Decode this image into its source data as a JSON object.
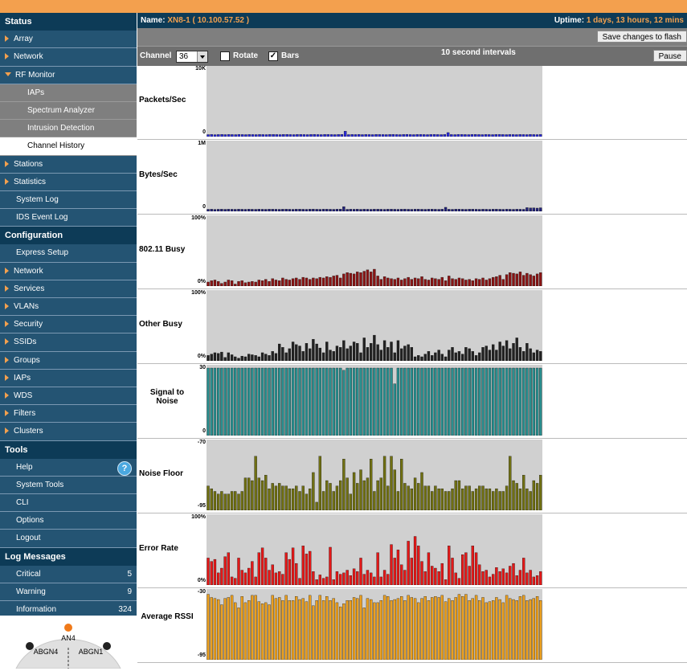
{
  "sidebar": {
    "status_header": "Status",
    "status_items": [
      {
        "label": "Array",
        "type": "item"
      },
      {
        "label": "Network",
        "type": "item"
      },
      {
        "label": "RF Monitor",
        "type": "expanded"
      },
      {
        "label": "IAPs",
        "type": "sub"
      },
      {
        "label": "Spectrum Analyzer",
        "type": "sub"
      },
      {
        "label": "Intrusion Detection",
        "type": "sub"
      },
      {
        "label": "Channel History",
        "type": "sub-active"
      },
      {
        "label": "Stations",
        "type": "item"
      },
      {
        "label": "Statistics",
        "type": "item"
      },
      {
        "label": "System Log",
        "type": "leaf"
      },
      {
        "label": "IDS Event Log",
        "type": "leaf"
      }
    ],
    "config_header": "Configuration",
    "config_items": [
      {
        "label": "Express Setup",
        "type": "leaf"
      },
      {
        "label": "Network",
        "type": "item"
      },
      {
        "label": "Services",
        "type": "item"
      },
      {
        "label": "VLANs",
        "type": "item"
      },
      {
        "label": "Security",
        "type": "item"
      },
      {
        "label": "SSIDs",
        "type": "item"
      },
      {
        "label": "Groups",
        "type": "item"
      },
      {
        "label": "IAPs",
        "type": "item"
      },
      {
        "label": "WDS",
        "type": "item"
      },
      {
        "label": "Filters",
        "type": "item"
      },
      {
        "label": "Clusters",
        "type": "item"
      }
    ],
    "tools_header": "Tools",
    "tools_items": [
      {
        "label": "Help",
        "type": "help"
      },
      {
        "label": "System Tools",
        "type": "leaf"
      },
      {
        "label": "CLI",
        "type": "leaf"
      },
      {
        "label": "Options",
        "type": "leaf"
      },
      {
        "label": "Logout",
        "type": "leaf"
      }
    ],
    "log_header": "Log Messages",
    "log_items": [
      {
        "label": "Critical",
        "count": "5"
      },
      {
        "label": "Warning",
        "count": "9"
      },
      {
        "label": "Information",
        "count": "324"
      }
    ],
    "ap_labels": {
      "top": "AN4",
      "left": "ABGN4",
      "right": "ABGN1"
    }
  },
  "header": {
    "name_label": "Name:",
    "name_value": "XN8-1",
    "ip_value": "( 10.100.57.52 )",
    "uptime_label": "Uptime:",
    "uptime_value": "1 days, 13 hours, 12 mins"
  },
  "save_button": "Save changes to flash",
  "controls": {
    "channel_label": "Channel",
    "channel_value": "36",
    "rotate_label": "Rotate",
    "rotate_checked": false,
    "bars_label": "Bars",
    "bars_checked": true,
    "interval_label": "10 second intervals",
    "pause_label": "Pause"
  },
  "colors": {
    "packets": "#2b2bd6",
    "bytes": "#22227a",
    "busy": "#8a1414",
    "other": "#222222",
    "snr": "#2a8f8f",
    "noise": "#707012",
    "error": "#e41818",
    "rssi": "#eba020",
    "accent": "#f3a04e",
    "nav": "#245473"
  },
  "chart_data": [
    {
      "type": "bar",
      "title": "Packets/Sec",
      "ymax_label": "10K",
      "ymin_label": "0",
      "ylim": [
        0,
        10000
      ],
      "color": "packets",
      "values": [
        300,
        320,
        290,
        310,
        330,
        300,
        320,
        310,
        300,
        330,
        310,
        300,
        320,
        310,
        300,
        320,
        310,
        300,
        330,
        320,
        310,
        300,
        320,
        330,
        310,
        300,
        320,
        330,
        310,
        300,
        320,
        340,
        310,
        300,
        330,
        320,
        310,
        300,
        320,
        330,
        800,
        300,
        320,
        310,
        330,
        300,
        320,
        310,
        300,
        330,
        320,
        310,
        300,
        320,
        330,
        310,
        300,
        320,
        340,
        310,
        300,
        320,
        330,
        310,
        300,
        320,
        330,
        310,
        300,
        320,
        600,
        310,
        300,
        330,
        320,
        310,
        300,
        320,
        330,
        310,
        300,
        320,
        310,
        300,
        320,
        330,
        310,
        300,
        320,
        310,
        300,
        320,
        310,
        300,
        330,
        310,
        300,
        320
      ]
    },
    {
      "type": "bar",
      "title": "Bytes/Sec",
      "ymax_label": "1M",
      "ymin_label": "0",
      "ylim": [
        0,
        1000000
      ],
      "color": "bytes",
      "values": [
        30000,
        32000,
        29000,
        31000,
        33000,
        30000,
        32000,
        31000,
        30000,
        33000,
        31000,
        30000,
        32000,
        31000,
        30000,
        32000,
        31000,
        30000,
        33000,
        32000,
        31000,
        30000,
        32000,
        33000,
        31000,
        30000,
        32000,
        33000,
        31000,
        30000,
        32000,
        34000,
        31000,
        30000,
        33000,
        32000,
        31000,
        30000,
        32000,
        33000,
        70000,
        30000,
        32000,
        31000,
        33000,
        30000,
        32000,
        31000,
        30000,
        33000,
        32000,
        31000,
        30000,
        32000,
        33000,
        31000,
        30000,
        32000,
        34000,
        31000,
        30000,
        32000,
        33000,
        31000,
        30000,
        32000,
        33000,
        31000,
        30000,
        32000,
        60000,
        31000,
        30000,
        33000,
        32000,
        31000,
        30000,
        32000,
        33000,
        31000,
        30000,
        32000,
        31000,
        30000,
        32000,
        33000,
        31000,
        30000,
        32000,
        31000,
        30000,
        32000,
        31000,
        30000,
        55000,
        50000,
        52000,
        48000,
        53000
      ]
    },
    {
      "type": "bar",
      "title": "802.11 Busy",
      "ymax_label": "100%",
      "ymin_label": "0%",
      "ylim": [
        0,
        100
      ],
      "color": "busy",
      "values": [
        6,
        8,
        9,
        7,
        4,
        6,
        9,
        8,
        3,
        7,
        8,
        5,
        6,
        7,
        6,
        9,
        8,
        10,
        7,
        11,
        9,
        8,
        12,
        10,
        9,
        11,
        12,
        10,
        13,
        12,
        10,
        12,
        11,
        13,
        12,
        14,
        13,
        15,
        16,
        12,
        18,
        20,
        19,
        18,
        21,
        20,
        22,
        24,
        21,
        25,
        15,
        10,
        14,
        12,
        11,
        10,
        12,
        9,
        11,
        13,
        10,
        12,
        11,
        14,
        10,
        9,
        12,
        11,
        10,
        13,
        8,
        15,
        11,
        10,
        12,
        11,
        9,
        10,
        8,
        11,
        10,
        12,
        9,
        11,
        13,
        14,
        16,
        10,
        17,
        20,
        19,
        18,
        21,
        16,
        19,
        17,
        15,
        18,
        20
      ]
    },
    {
      "type": "bar",
      "title": "Other Busy",
      "ymax_label": "100%",
      "ymin_label": "0%",
      "ylim": [
        0,
        100
      ],
      "color": "other",
      "values": [
        8,
        10,
        12,
        11,
        13,
        5,
        12,
        9,
        6,
        4,
        7,
        6,
        10,
        9,
        8,
        6,
        12,
        10,
        8,
        14,
        11,
        25,
        20,
        12,
        18,
        28,
        24,
        22,
        14,
        26,
        18,
        32,
        25,
        19,
        12,
        28,
        16,
        14,
        22,
        20,
        30,
        18,
        22,
        28,
        26,
        12,
        34,
        20,
        26,
        38,
        24,
        16,
        30,
        20,
        28,
        12,
        30,
        18,
        22,
        24,
        20,
        6,
        8,
        6,
        10,
        14,
        8,
        12,
        16,
        10,
        6,
        16,
        20,
        12,
        14,
        10,
        20,
        18,
        14,
        8,
        12,
        20,
        22,
        16,
        24,
        16,
        28,
        22,
        30,
        18,
        26,
        34,
        20,
        14,
        26,
        18,
        12,
        16,
        14
      ]
    },
    {
      "type": "bar",
      "title": "Signal to Noise",
      "ymax_label": "30",
      "ymin_label": "0",
      "ylim": [
        0,
        30
      ],
      "color": "snr",
      "values": [
        30,
        30,
        30,
        30,
        30,
        30,
        30,
        30,
        30,
        30,
        30,
        30,
        30,
        30,
        30,
        30,
        30,
        30,
        30,
        30,
        30,
        30,
        30,
        30,
        30,
        30,
        30,
        30,
        30,
        30,
        30,
        30,
        30,
        30,
        30,
        30,
        30,
        30,
        30,
        30,
        29,
        30,
        30,
        30,
        30,
        30,
        30,
        30,
        30,
        30,
        30,
        30,
        30,
        30,
        30,
        23,
        30,
        30,
        30,
        30,
        30,
        30,
        30,
        30,
        30,
        30,
        30,
        30,
        30,
        30,
        30,
        30,
        30,
        30,
        30,
        30,
        30,
        30,
        30,
        30,
        30,
        30,
        30,
        30,
        30,
        30,
        30,
        30,
        30,
        30,
        30,
        30,
        30,
        30,
        30,
        30,
        30,
        30,
        30
      ]
    },
    {
      "type": "bar",
      "title": "Noise Floor",
      "ymax_label": "-70",
      "ymin_label": "-95",
      "ylim": [
        -95,
        -70
      ],
      "color": "noise",
      "values": [
        -86,
        -87,
        -88,
        -89,
        -88,
        -89,
        -89,
        -88,
        -88,
        -89,
        -88,
        -83,
        -83,
        -84,
        -75,
        -83,
        -84,
        -82,
        -87,
        -85,
        -86,
        -85,
        -86,
        -86,
        -87,
        -87,
        -86,
        -88,
        -86,
        -89,
        -87,
        -81,
        -92,
        -75,
        -88,
        -84,
        -85,
        -88,
        -86,
        -84,
        -76,
        -83,
        -89,
        -81,
        -85,
        -80,
        -84,
        -83,
        -76,
        -88,
        -84,
        -83,
        -75,
        -86,
        -75,
        -80,
        -88,
        -76,
        -85,
        -86,
        -87,
        -83,
        -85,
        -81,
        -86,
        -86,
        -88,
        -86,
        -87,
        -87,
        -88,
        -88,
        -87,
        -84,
        -84,
        -87,
        -86,
        -86,
        -88,
        -87,
        -86,
        -86,
        -87,
        -87,
        -88,
        -87,
        -88,
        -88,
        -86,
        -75,
        -84,
        -85,
        -87,
        -82,
        -87,
        -88,
        -84,
        -85,
        -82
      ]
    },
    {
      "type": "bar",
      "title": "Error Rate",
      "ymax_label": "100%",
      "ymin_label": "0%",
      "ylim": [
        0,
        100
      ],
      "color": "error",
      "values": [
        40,
        35,
        38,
        18,
        25,
        42,
        48,
        12,
        10,
        40,
        22,
        18,
        25,
        35,
        12,
        48,
        55,
        40,
        22,
        30,
        18,
        20,
        16,
        48,
        38,
        55,
        32,
        10,
        58,
        46,
        50,
        20,
        8,
        15,
        10,
        12,
        56,
        8,
        20,
        16,
        18,
        22,
        14,
        24,
        20,
        40,
        16,
        22,
        18,
        12,
        48,
        12,
        22,
        16,
        60,
        40,
        52,
        30,
        22,
        65,
        40,
        72,
        58,
        35,
        20,
        48,
        28,
        25,
        20,
        32,
        8,
        58,
        40,
        18,
        10,
        45,
        48,
        28,
        58,
        48,
        30,
        20,
        22,
        12,
        16,
        26,
        20,
        24,
        18,
        28,
        32,
        14,
        22,
        40,
        18,
        22,
        12,
        14,
        20
      ]
    },
    {
      "type": "bar",
      "title": "Average RSSI",
      "ymax_label": "-30",
      "ymin_label": "-95",
      "ylim": [
        -95,
        -30
      ],
      "color": "rssi",
      "values": [
        -32,
        -35,
        -36,
        -37,
        -42,
        -36,
        -35,
        -33,
        -40,
        -45,
        -34,
        -40,
        -38,
        -33,
        -33,
        -39,
        -41,
        -40,
        -42,
        -33,
        -36,
        -35,
        -38,
        -33,
        -38,
        -38,
        -34,
        -37,
        -36,
        -39,
        -33,
        -43,
        -38,
        -33,
        -38,
        -34,
        -38,
        -36,
        -40,
        -44,
        -41,
        -38,
        -38,
        -35,
        -36,
        -33,
        -45,
        -36,
        -37,
        -40,
        -40,
        -38,
        -33,
        -34,
        -38,
        -37,
        -36,
        -34,
        -38,
        -33,
        -35,
        -36,
        -40,
        -36,
        -34,
        -38,
        -35,
        -34,
        -35,
        -33,
        -39,
        -36,
        -38,
        -35,
        -32,
        -34,
        -32,
        -38,
        -36,
        -33,
        -38,
        -35,
        -40,
        -39,
        -38,
        -35,
        -37,
        -40,
        -33,
        -36,
        -37,
        -38,
        -34,
        -33,
        -38,
        -37,
        -36,
        -34,
        -38
      ]
    }
  ]
}
